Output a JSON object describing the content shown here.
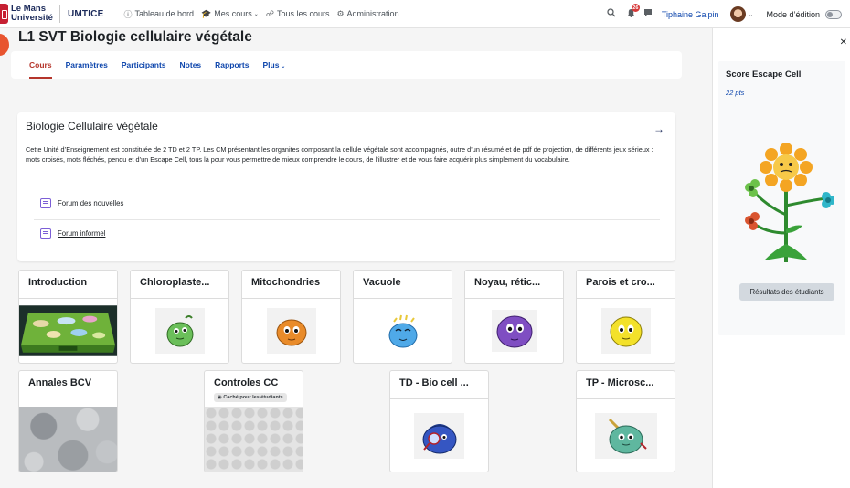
{
  "brand": {
    "university_line1": "Le Mans",
    "university_line2": "Université",
    "site": "UMTICE"
  },
  "nav": {
    "items": [
      {
        "label": "Tableau de bord",
        "icon": "dashboard-icon"
      },
      {
        "label": "Mes cours",
        "icon": "graduation-cap-icon",
        "has_menu": true
      },
      {
        "label": "Tous les cours",
        "icon": "sitemap-icon"
      },
      {
        "label": "Administration",
        "icon": "gear-icon"
      }
    ],
    "notification_count": "26",
    "user_name": "Tiphaine Galpin",
    "edit_mode_label": "Mode d’édition"
  },
  "course": {
    "title": "L1 SVT Biologie cellulaire végétale",
    "tabs": [
      "Cours",
      "Paramètres",
      "Participants",
      "Notes",
      "Rapports",
      "Plus"
    ],
    "active_tab": "Cours"
  },
  "summary": {
    "title": "Biologie Cellulaire végétale",
    "description": "Cette Unité d’Enseignement est constituée de 2 TD et 2 TP. Les CM présentant les organites composant la cellule végétale sont accompagnés, outre d’un résumé et de pdf de projection, de différents jeux sérieux : mots croisés, mots fléchés, pendu et d’un Escape Cell, tous là pour vous permettre de mieux comprendre le cours, de l’illustrer et de vous faire acquérir plus simplement du vocabulaire.",
    "forums": [
      "Forum des nouvelles",
      "Forum informel"
    ]
  },
  "tiles": [
    {
      "title": "Introduction"
    },
    {
      "title": "Chloroplaste..."
    },
    {
      "title": "Mitochondries"
    },
    {
      "title": "Vacuole"
    },
    {
      "title": "Noyau, rétic..."
    },
    {
      "title": "Parois et cro..."
    },
    {
      "title": "Annales BCV"
    },
    {
      "title": "Controles CC",
      "badge": "Caché pour les étudiants"
    },
    {
      "title": "TD - Bio cell ..."
    },
    {
      "title": "TP - Microsc..."
    }
  ],
  "drawer": {
    "block_title": "Score Escape Cell",
    "points": "22 pts",
    "button_label": "Résultats des étudiants"
  },
  "colors": {
    "accent": "#0f47ad",
    "active_tab": "#b5352b",
    "brand_red": "#c62032"
  }
}
